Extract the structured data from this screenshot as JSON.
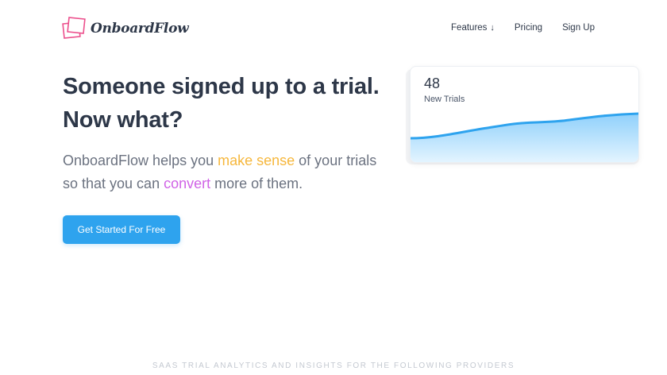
{
  "brand": {
    "name": "OnboardFlow",
    "logo_icon": "stacked-cards-logo"
  },
  "nav": {
    "items": [
      {
        "label": "Features",
        "suffix": "↓"
      },
      {
        "label": "Pricing"
      },
      {
        "label": "Sign Up"
      }
    ]
  },
  "hero": {
    "title_line1": "Someone signed up to a trial.",
    "title_line2": "Now what?",
    "sub_part1": "OnboardFlow helps you ",
    "sub_highlight1": "make sense",
    "sub_part2": " of your trials so that you can ",
    "sub_highlight2": "convert",
    "sub_part3": " more of them.",
    "cta_label": "Get Started For Free"
  },
  "stats_card": {
    "value": "48",
    "label": "New Trials"
  },
  "providers_text": "SAAS TRIAL ANALYTICS AND INSIGHTS FOR THE FOLLOWING PROVIDERS",
  "colors": {
    "accent_blue": "#2ea3ee",
    "highlight_yellow": "#f6b73c",
    "highlight_purple": "#d063e6",
    "logo_pink": "#ec4f8c"
  }
}
